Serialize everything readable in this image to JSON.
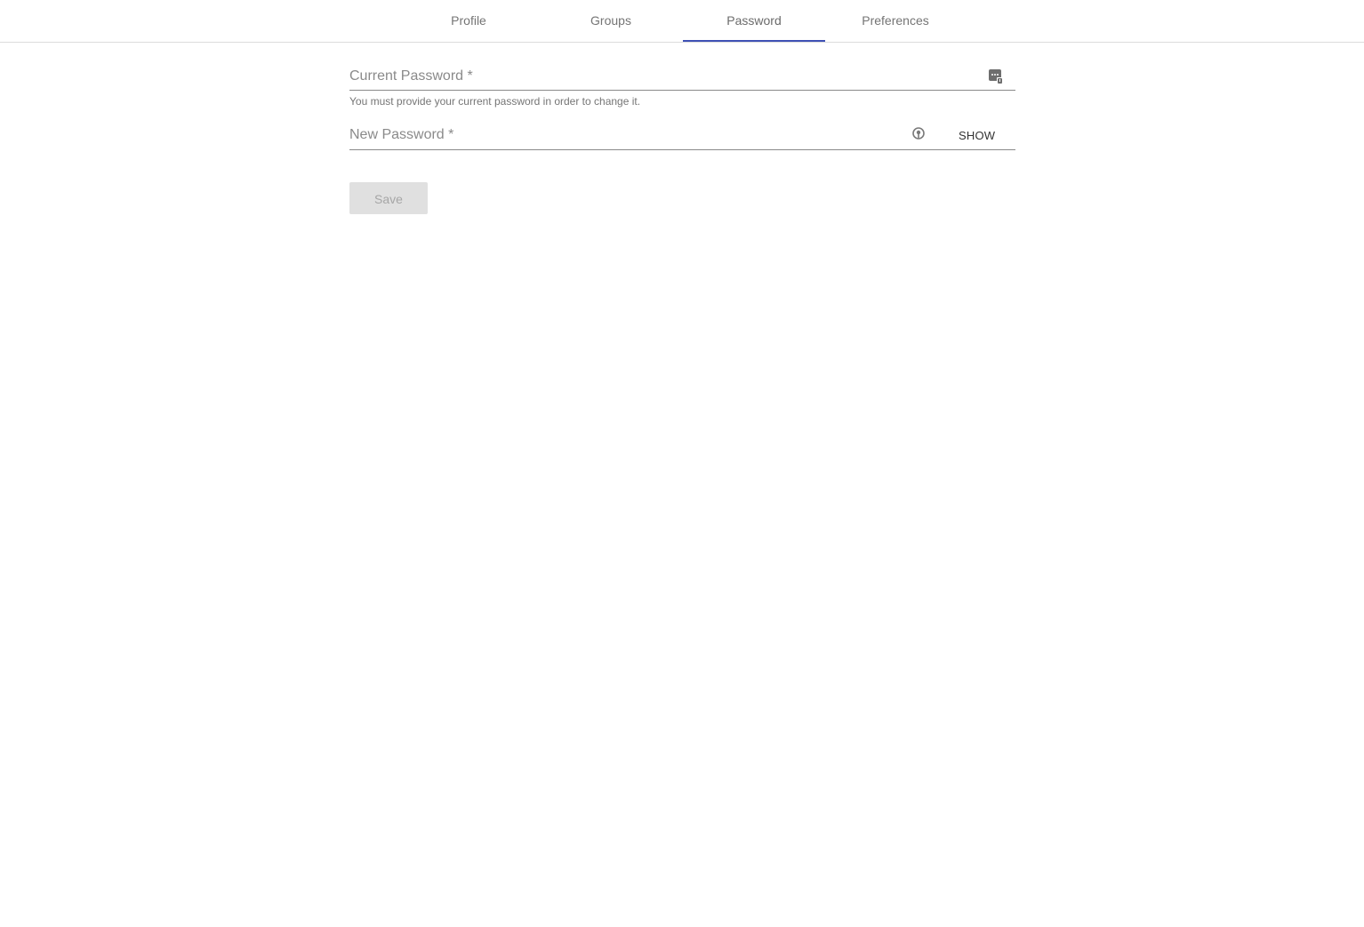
{
  "tabs": [
    {
      "label": "Profile",
      "active": false
    },
    {
      "label": "Groups",
      "active": false
    },
    {
      "label": "Password",
      "active": true
    },
    {
      "label": "Preferences",
      "active": false
    }
  ],
  "accent_color": "#3f51b5",
  "current_password": {
    "label": "Current Password *",
    "value": "",
    "helper_text": "You must provide your current password in order to change it.",
    "icon": "password-manager-icon"
  },
  "new_password": {
    "label": "New Password *",
    "value": "",
    "icon": "password-generator-icon",
    "show_label": "SHOW"
  },
  "save_button": {
    "label": "Save",
    "disabled": true
  }
}
